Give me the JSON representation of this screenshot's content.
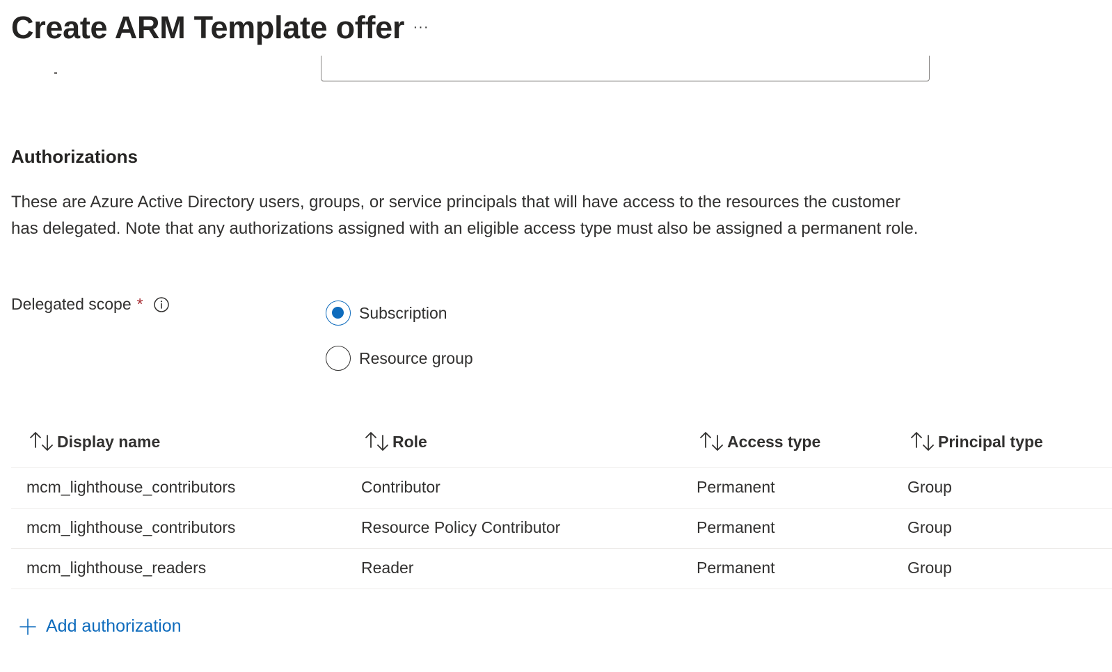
{
  "header": {
    "title": "Create ARM Template offer",
    "more_label": "···"
  },
  "section": {
    "heading": "Authorizations",
    "description": "These are Azure Active Directory users, groups, or service principals that will have access to the resources the customer has delegated. Note that any authorizations assigned with an eligible access type must also be assigned a permanent role."
  },
  "scope": {
    "label": "Delegated scope",
    "required_marker": "*",
    "options": [
      {
        "label": "Subscription",
        "selected": true
      },
      {
        "label": "Resource group",
        "selected": false
      }
    ]
  },
  "table": {
    "columns": [
      "Display name",
      "Role",
      "Access type",
      "Principal type"
    ],
    "rows": [
      [
        "mcm_lighthouse_contributors",
        "Contributor",
        "Permanent",
        "Group"
      ],
      [
        "mcm_lighthouse_contributors",
        "Resource Policy Contributor",
        "Permanent",
        "Group"
      ],
      [
        "mcm_lighthouse_readers",
        "Reader",
        "Permanent",
        "Group"
      ]
    ]
  },
  "actions": {
    "add_authorization": "Add authorization"
  },
  "colors": {
    "accent": "#0f6cbd",
    "text": "#323130",
    "required": "#a4262c",
    "divider": "#edebe9"
  },
  "icons": {
    "more": "more-horizontal-icon",
    "info": "info-icon",
    "sort": "sort-arrows-icon",
    "add": "plus-icon"
  }
}
